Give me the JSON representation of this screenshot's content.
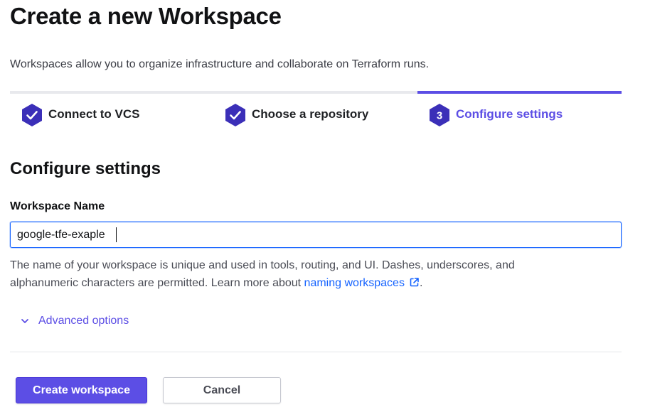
{
  "page": {
    "title": "Create a new Workspace",
    "description": "Workspaces allow you to organize infrastructure and collaborate on Terraform runs."
  },
  "steps": [
    {
      "label": "Connect to VCS",
      "status": "complete",
      "icon": "check-icon"
    },
    {
      "label": "Choose a repository",
      "status": "complete",
      "icon": "check-icon"
    },
    {
      "label": "Configure settings",
      "status": "active",
      "number": "3"
    }
  ],
  "form": {
    "section_title": "Configure settings",
    "workspace_name_label": "Workspace Name",
    "workspace_name_value": "google-tfe-exaple",
    "help_text": "The name of your workspace is unique and used in tools, routing, and UI. Dashes, underscores, and alphanumeric characters are permitted. Learn more about ",
    "help_link": "naming workspaces",
    "help_end": ".",
    "advanced_options_label": "Advanced options"
  },
  "actions": {
    "create_label": "Create workspace",
    "cancel_label": "Cancel"
  },
  "colors": {
    "accent": "#5c4ee5",
    "step_complete": "#3b2fb8",
    "link": "#1563ff",
    "focus_border": "#1563ff"
  }
}
